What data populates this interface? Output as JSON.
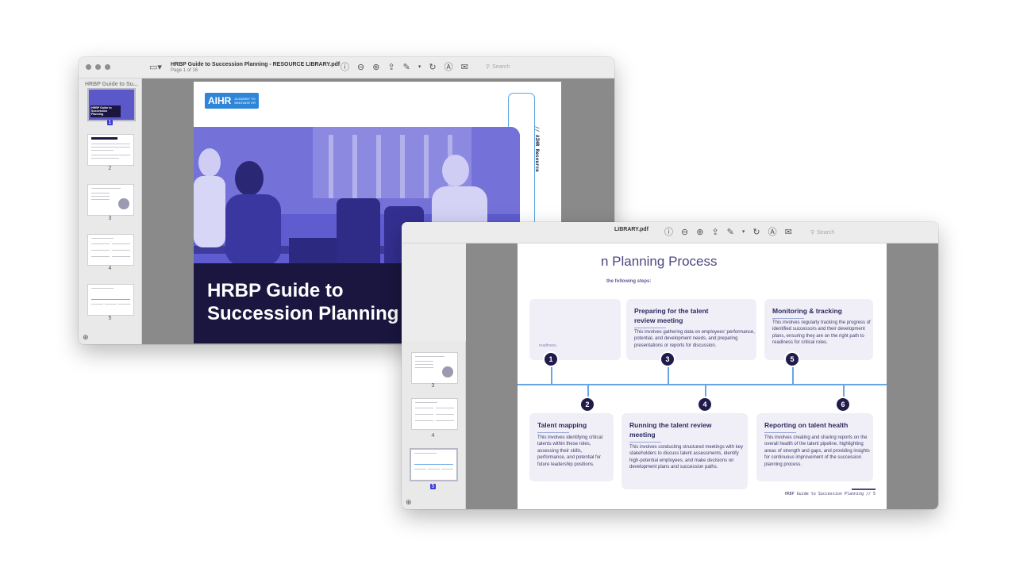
{
  "window1": {
    "doc_title": "HRBP Guide to Succession Planning - RESOURCE LIBRARY.pdf",
    "page_info": "Page 1 of 16",
    "sidebar_title": "HRBP Guide to Su...",
    "search_placeholder": "Search",
    "thumbnails": [
      {
        "label": "1",
        "selected": true
      },
      {
        "label": "2",
        "selected": false
      },
      {
        "label": "3",
        "selected": false
      },
      {
        "label": "4",
        "selected": false
      },
      {
        "label": "5",
        "selected": false
      }
    ],
    "thumb1_title": "HRBP Guide to Succession Planning"
  },
  "cover": {
    "logo_main": "AIHR",
    "logo_sub": "ACADEMY TO INNOVATE HR",
    "side_label": "// AIHR Resource",
    "title": "HRBP Guide to Succession Planning"
  },
  "window2": {
    "doc_title_fragment": "LIBRARY.pdf",
    "search_placeholder": "Search",
    "thumbnails": [
      {
        "label": "3",
        "selected": false
      },
      {
        "label": "4",
        "selected": false
      },
      {
        "label": "5",
        "selected": true
      }
    ]
  },
  "page2": {
    "heading": "n Planning Process",
    "intro": "the following steps:",
    "hidden_card_fragment": "readiness.",
    "steps": [
      {
        "num": "1"
      },
      {
        "num": "2",
        "title": "Talent mapping",
        "body": "This involves identifying critical talents within these roles, assessing their skills, performance, and potential for future leadership positions."
      },
      {
        "num": "3",
        "title": "Preparing for the talent review meeting",
        "body": "This involves gathering data on employees' performance, potential, and development needs, and preparing presentations or reports for discussion."
      },
      {
        "num": "4",
        "title": "Running the talent review meeting",
        "body": "This involves conducting structured meetings with key stakeholders to discuss talent assessments, identify high-potential employees, and make decisions on development plans and succession paths."
      },
      {
        "num": "5",
        "title": "Monitoring & tracking",
        "body": "This involves regularly tracking the progress of identified successors and their development plans, ensuring they are on the right path to readiness for critical roles."
      },
      {
        "num": "6",
        "title": "Reporting on talent health",
        "body": "This involves creating and sharing reports on the overall health of the talent pipeline, highlighting areas of strength and gaps, and providing insights for continuous improvement of the succession planning process."
      }
    ],
    "footer": "HRBP Guide to Succession Planning // 5"
  },
  "colors": {
    "accent_blue": "#2f86d8",
    "navy": "#1a1640",
    "card_bg": "#f0eff8",
    "photo_tint": "#5b58c9"
  }
}
